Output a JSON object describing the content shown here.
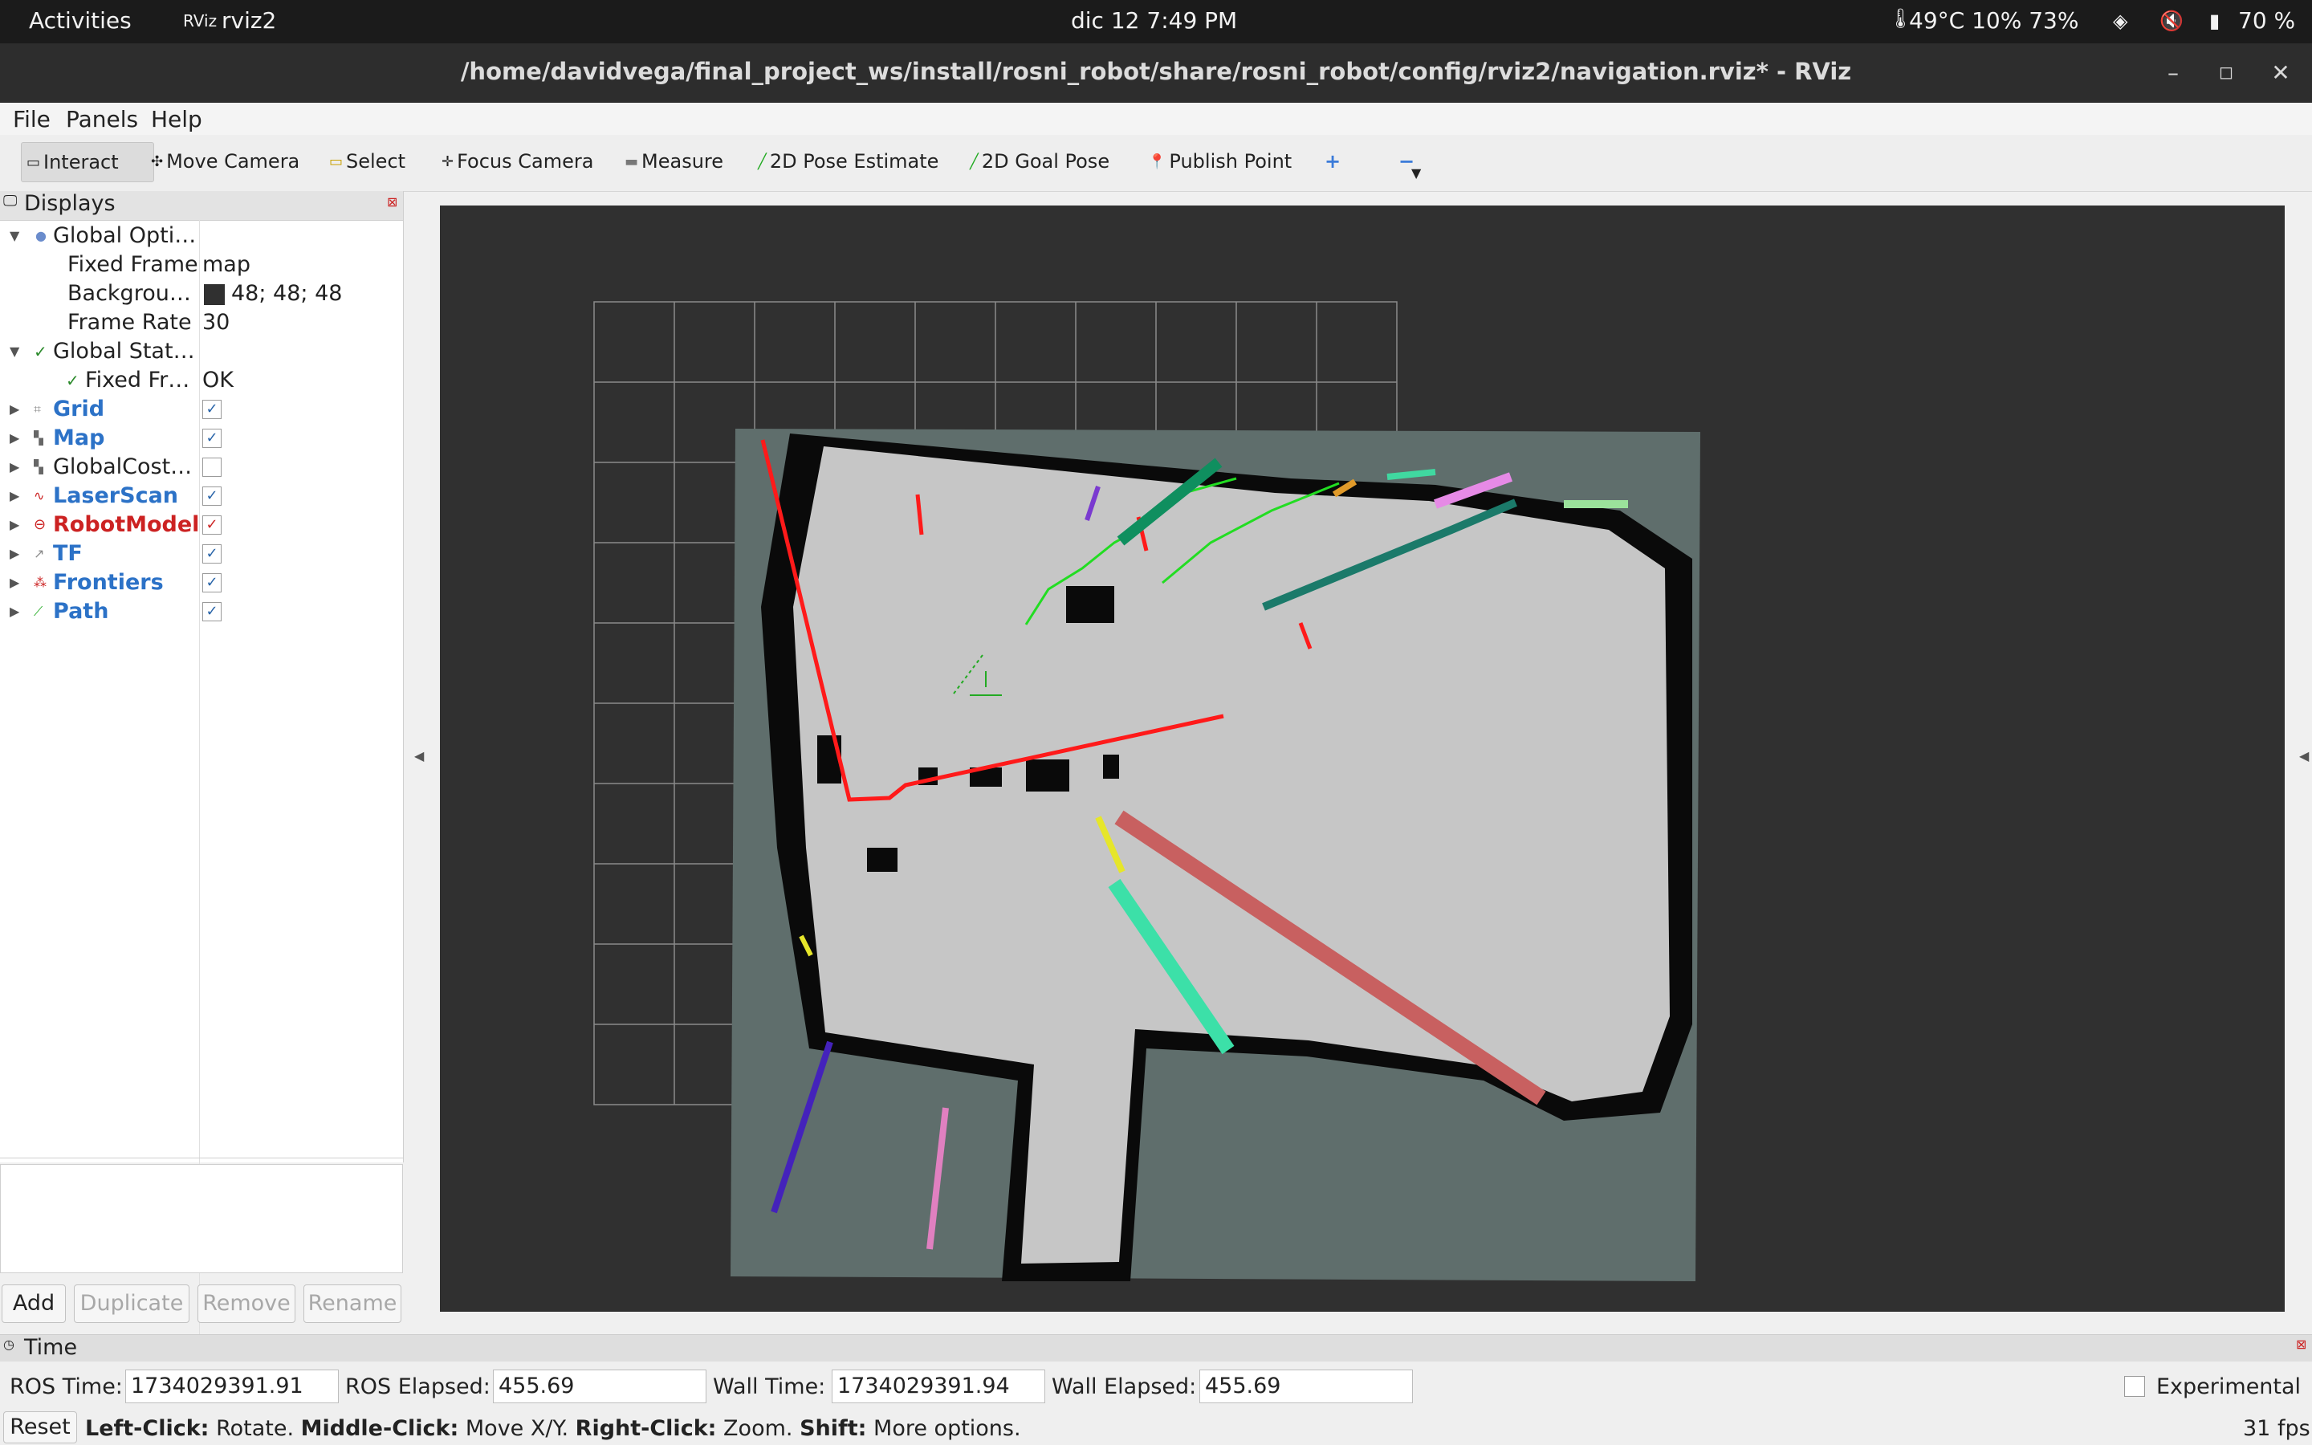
{
  "topbar": {
    "activities": "Activities",
    "app_name": "rviz2",
    "app_icon": "RViz",
    "datetime": "dic 12  7:49 PM",
    "sensors": "49°C 10% 73%",
    "battery": "70 %"
  },
  "window": {
    "title": "/home/davidvega/final_project_ws/install/rosni_robot/share/rosni_robot/config/rviz2/navigation.rviz* - RViz",
    "minimize": "–",
    "maximize": "◻",
    "close": "✕"
  },
  "menu": {
    "file": "File",
    "panels": "Panels",
    "help": "Help"
  },
  "toolbar": {
    "interact": "Interact",
    "move_camera": "Move Camera",
    "select": "Select",
    "focus_camera": "Focus Camera",
    "measure": "Measure",
    "pose_estimate": "2D Pose Estimate",
    "goal_pose": "2D Goal Pose",
    "publish_point": "Publish Point",
    "plus": "+",
    "minus": "−"
  },
  "displays": {
    "title": "Displays",
    "global_options": "Global Opti…",
    "fixed_frame_label": "Fixed Frame",
    "fixed_frame_value": "map",
    "background_label": "Backgrou…",
    "background_value": "48; 48; 48",
    "frame_rate_label": "Frame Rate",
    "frame_rate_value": "30",
    "global_status": "Global Stat…",
    "fixed_frame_status_label": "Fixed Fr…",
    "fixed_frame_status_value": "OK",
    "items": [
      {
        "label": "Grid",
        "checked": true
      },
      {
        "label": "Map",
        "checked": true
      },
      {
        "label": "GlobalCost…",
        "checked": false
      },
      {
        "label": "LaserScan",
        "checked": true
      },
      {
        "label": "RobotModel",
        "checked": true
      },
      {
        "label": "TF",
        "checked": true
      },
      {
        "label": "Frontiers",
        "checked": true
      },
      {
        "label": "Path",
        "checked": true
      }
    ],
    "buttons": {
      "add": "Add",
      "duplicate": "Duplicate",
      "remove": "Remove",
      "rename": "Rename"
    }
  },
  "time": {
    "title": "Time",
    "ros_time_label": "ROS Time:",
    "ros_time": "1734029391.91",
    "ros_elapsed_label": "ROS Elapsed:",
    "ros_elapsed": "455.69",
    "wall_time_label": "Wall Time:",
    "wall_time": "1734029391.94",
    "wall_elapsed_label": "Wall Elapsed:",
    "wall_elapsed": "455.69",
    "experimental": "Experimental"
  },
  "status": {
    "reset": "Reset",
    "left_click": "Left-Click:",
    "left_click_desc": "Rotate.",
    "middle_click": "Middle-Click:",
    "middle_click_desc": "Move X/Y.",
    "right_click": "Right-Click:",
    "right_click_desc": "Zoom.",
    "shift": "Shift:",
    "shift_desc": "More options.",
    "fps": "31 fps"
  },
  "colors": {
    "viewport_bg": "#303030",
    "map_unknown": "#5f6e6c",
    "map_free": "#c6c6c6",
    "map_occupied": "#000000",
    "laser": "#ff0000",
    "path": "#22dd22"
  }
}
